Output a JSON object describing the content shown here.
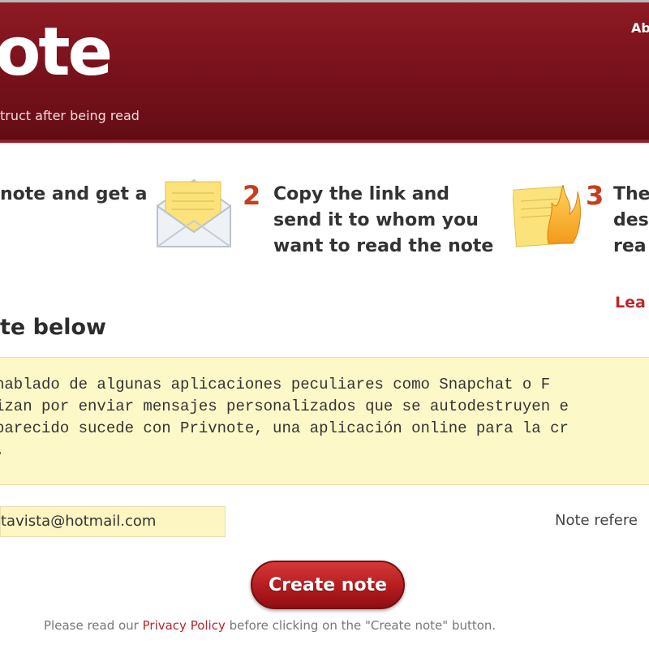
{
  "header": {
    "logo_text": "ote",
    "tagline": "truct after being read",
    "nav_about": "Ab"
  },
  "steps": [
    {
      "number": "",
      "text_lines": [
        "note and get a"
      ],
      "icon": "note-icon"
    },
    {
      "number": "2",
      "text_lines": [
        "Copy the link and",
        "send it to whom you",
        "want to read the note"
      ],
      "icon": "envelope-icon"
    },
    {
      "number": "3",
      "text_lines": [
        "The",
        "des",
        "rea"
      ],
      "icon": "burning-note-icon"
    }
  ],
  "learn_more": "Lea",
  "section_title": "te below",
  "note": {
    "lines": [
      " hablado de algunas aplicaciones peculiares como Snapchat o F",
      "izan por enviar mensajes personalizados que se autodestruyen e",
      "parecido sucede con Privnote, una aplicación online para la cr",
      "."
    ]
  },
  "email_field": {
    "value": "tavista@hotmail.com"
  },
  "note_reference": "Note refere",
  "create_button": "Create note",
  "footer": {
    "before": "Please read our ",
    "link": "Privacy Policy",
    "after": " before clicking on the \"Create note\" button."
  },
  "colors": {
    "header_bg": "#7a121c",
    "accent_red": "#c63d1c",
    "note_bg": "#fdf8c8",
    "button_red": "#b81d20"
  }
}
